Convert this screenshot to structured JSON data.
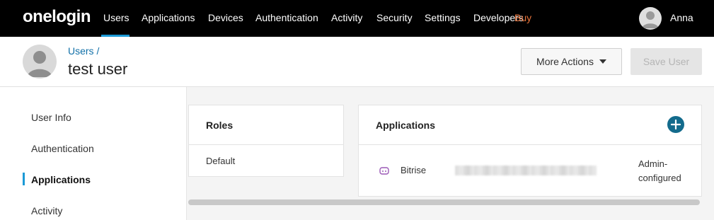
{
  "brand": {
    "logo_text": "onelogin"
  },
  "nav": {
    "items": [
      "Users",
      "Applications",
      "Devices",
      "Authentication",
      "Activity",
      "Security",
      "Settings",
      "Developers"
    ],
    "buy_label": "Buy",
    "active": "Users"
  },
  "account": {
    "name": "Anna"
  },
  "header": {
    "breadcrumb": "Users /",
    "title": "test user",
    "more_actions_label": "More Actions",
    "save_label": "Save User"
  },
  "sidebar": {
    "items": [
      "User Info",
      "Authentication",
      "Applications",
      "Activity"
    ],
    "active": "Applications"
  },
  "roles_card": {
    "title": "Roles",
    "rows": [
      "Default"
    ]
  },
  "apps_card": {
    "title": "Applications",
    "rows": [
      {
        "name": "Bitrise",
        "status_line1": "Admin-",
        "status_line2": "configured",
        "icon": "app-icon"
      }
    ]
  },
  "colors": {
    "accent": "#1b9ad6",
    "buy": "#e8743b",
    "plus": "#136b8c",
    "link": "#1170a8"
  }
}
